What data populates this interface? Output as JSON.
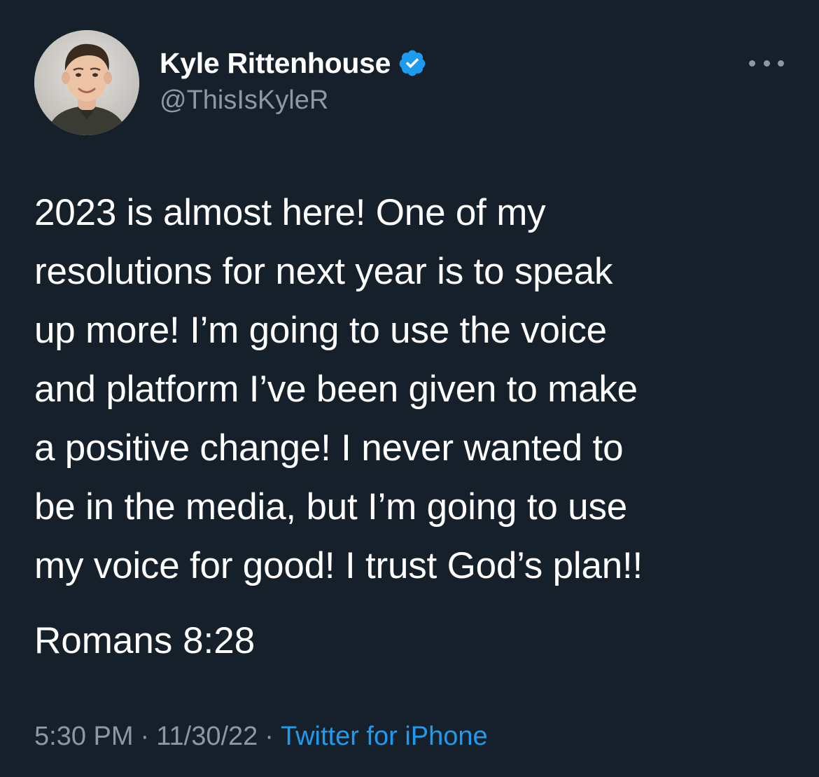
{
  "user": {
    "display_name": "Kyle Rittenhouse",
    "handle": "@ThisIsKyleR",
    "verified": true
  },
  "tweet": {
    "text": "2023 is almost here! One of my\nresolutions for next year is to speak\nup more! I’m going to use the voice\nand platform I’ve been given to make\na positive change! I never wanted to\nbe in the media, but I’m going to use\nmy voice for good! I trust God’s plan!!",
    "verse": "Romans 8:28",
    "time": "5:30 PM",
    "separator": "·",
    "date": "11/30/22",
    "source": "Twitter for iPhone"
  },
  "icons": {
    "verified": "verified-badge-icon",
    "more": "more-options-icon"
  },
  "colors": {
    "background": "#16202b",
    "primary_text": "#ffffff",
    "secondary_text": "#8b98a5",
    "accent": "#1d9bf0"
  }
}
